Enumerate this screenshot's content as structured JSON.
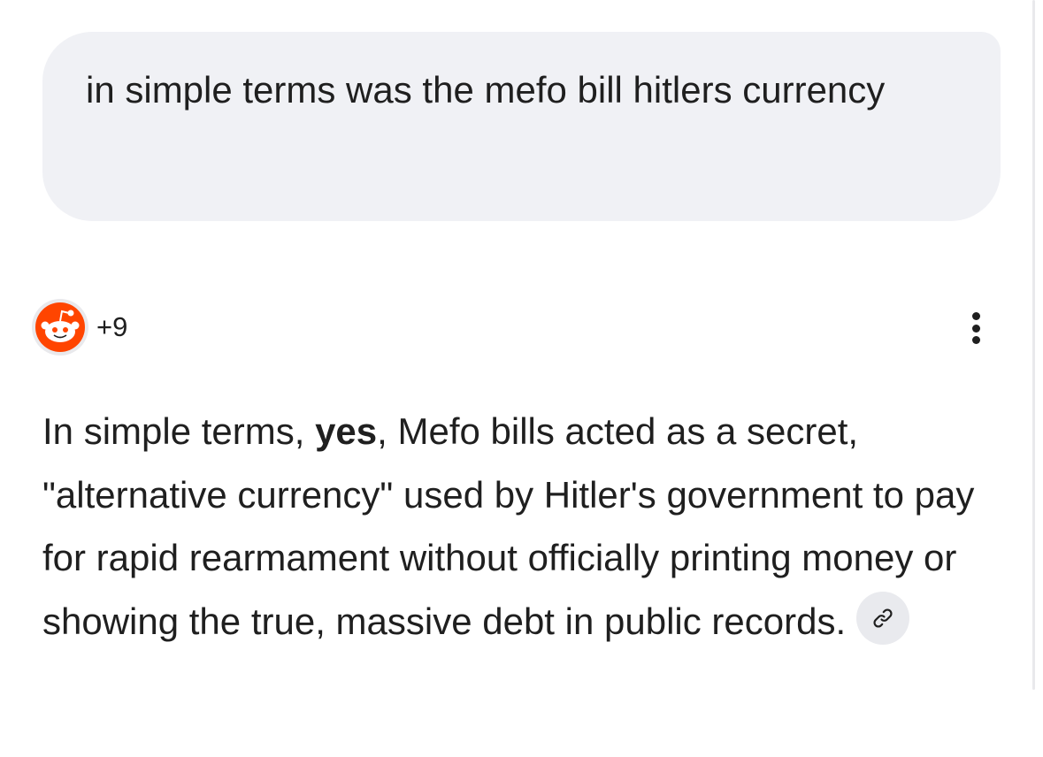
{
  "user_message": {
    "text": "in simple terms was the mefo bill hitlers currency"
  },
  "response": {
    "source_count": "+9",
    "source_icon": "reddit-icon",
    "menu_icon": "more-vert-icon",
    "answer": {
      "part1": "In simple terms, ",
      "bold": "yes",
      "part2": ", Mefo bills acted as a secret, \"alternative currency\" used by Hitler's government to pay for rapid rearmament without officially printing money or showing the true, massive debt in public records."
    },
    "link_icon": "link-icon"
  },
  "colors": {
    "bubble_bg": "#f0f1f5",
    "reddit_orange": "#ff4500",
    "text": "#1f1f1f"
  }
}
